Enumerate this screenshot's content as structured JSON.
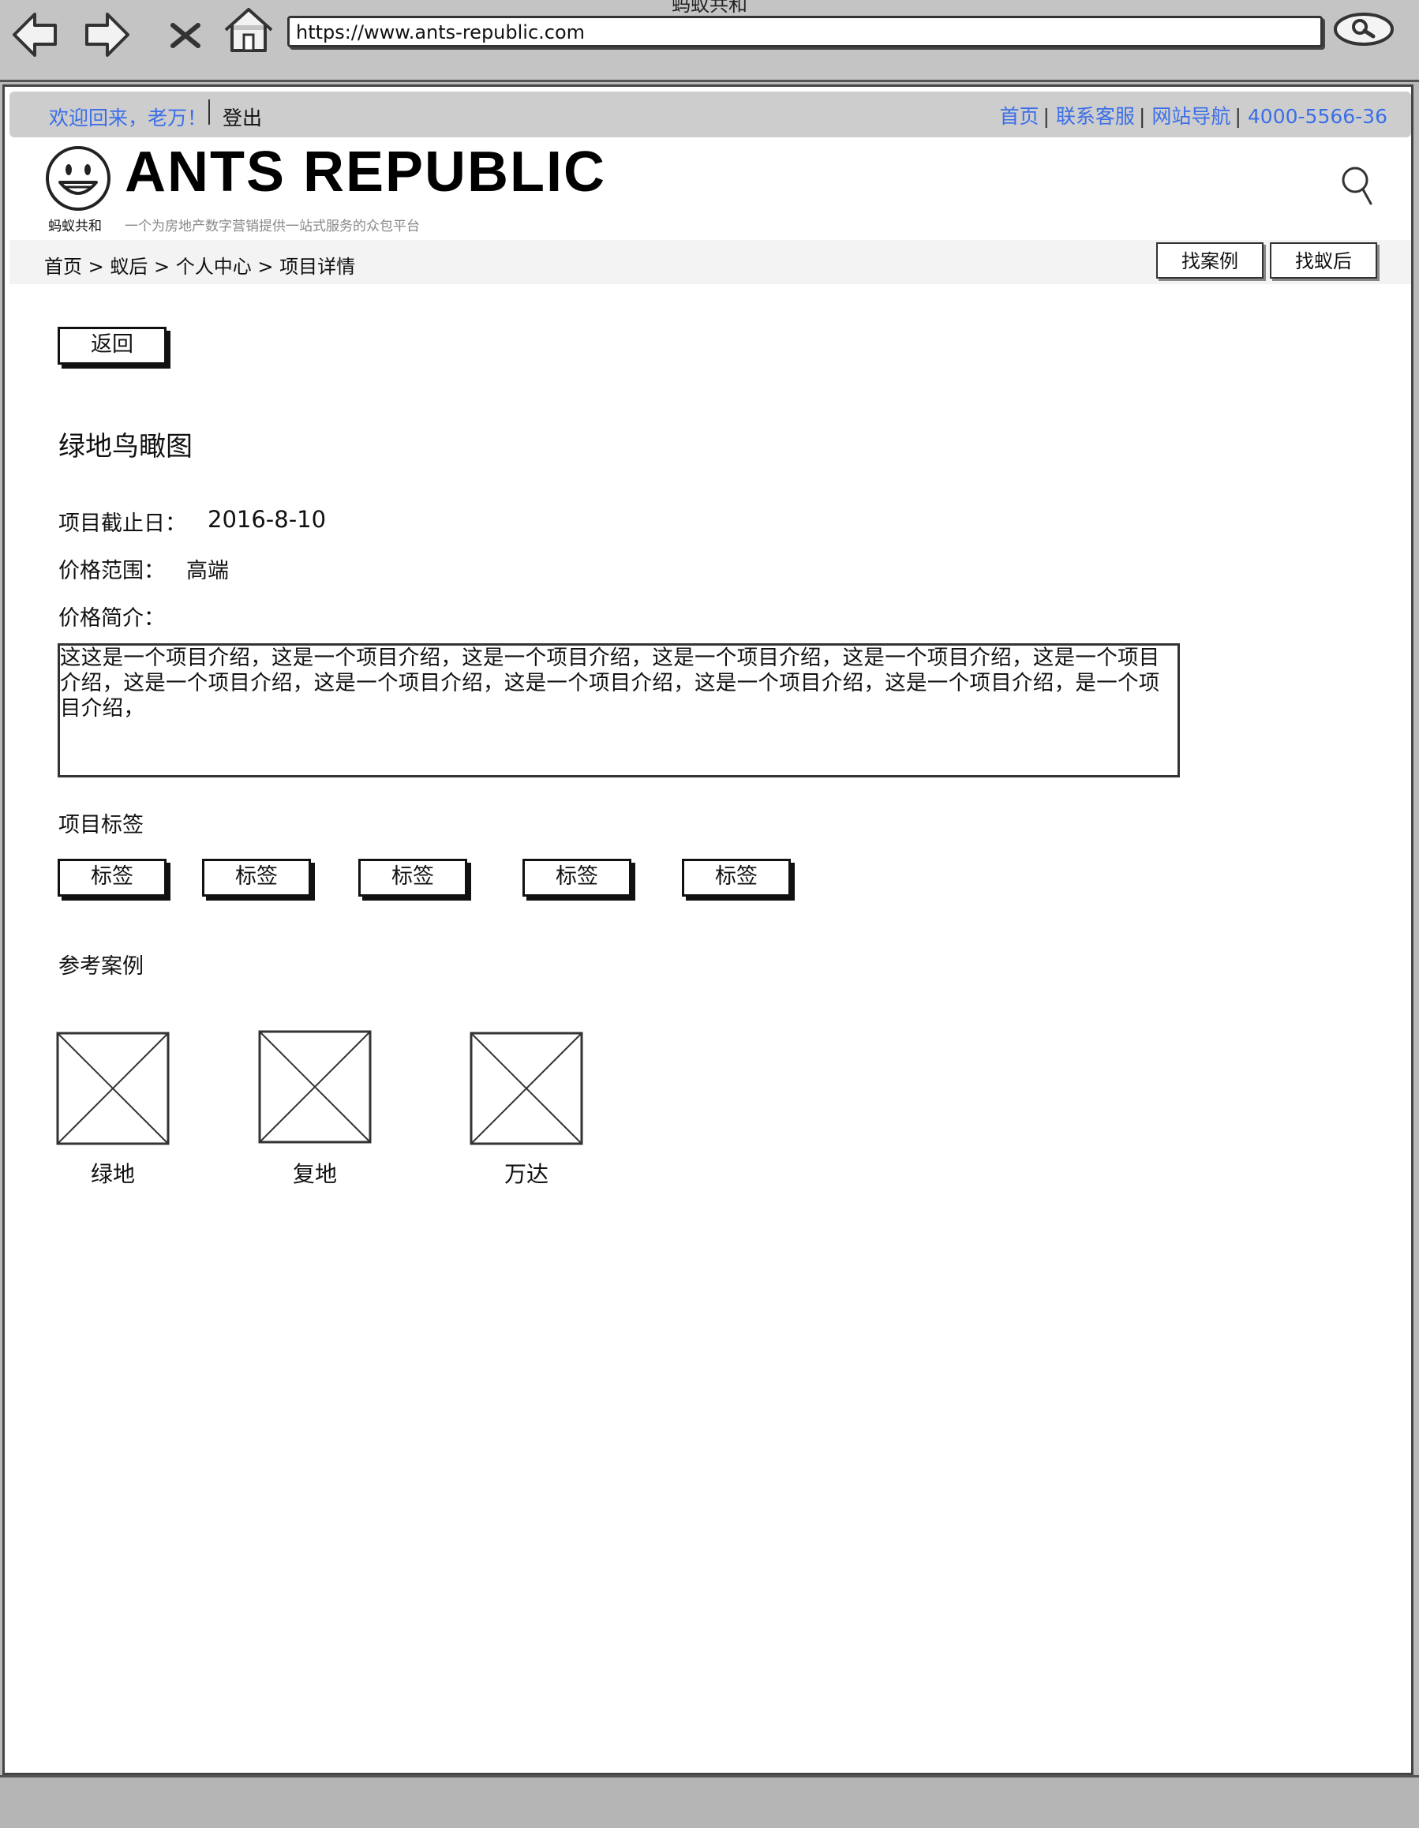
{
  "window": {
    "title": "蚂蚁共和",
    "url": "https://www.ants-republic.com"
  },
  "top_bar": {
    "greeting": "欢迎回来，老万！",
    "logout": "登出",
    "links": [
      "首页",
      "联系客服",
      "网站导航",
      "4000-5566-36"
    ]
  },
  "brand": {
    "name": "ANTS REPUBLIC",
    "cn_name": "蚂蚁共和",
    "slogan": "一个为房地产数字营销提供一站式服务的众包平台"
  },
  "breadcrumb": "首页 > 蚁后 > 个人中心 > 项目详情",
  "header_buttons": {
    "find_cases": "找案例",
    "find_ants": "找蚁后"
  },
  "main": {
    "back_button": "返回",
    "project_title": "绿地鸟瞰图",
    "deadline_label": "项目截止日：",
    "deadline_value": "2016-8-10",
    "price_range_label": "价格范围：",
    "price_range_value": "高端",
    "price_intro_label": "价格简介：",
    "price_intro_text": "这这是一个项目介绍，这是一个项目介绍，这是一个项目介绍，这是一个项目介绍，这是一个项目介绍，这是一个项目介绍，这是一个项目介绍，这是一个项目介绍，这是一个项目介绍，这是一个项目介绍，这是一个项目介绍，是一个项目介绍，",
    "tags_label": "项目标签",
    "tags": [
      "标签",
      "标签",
      "标签",
      "标签",
      "标签"
    ],
    "cases_label": "参考案例",
    "cases": [
      "绿地",
      "复地",
      "万达"
    ]
  },
  "colors": {
    "link": "#3b6ee8",
    "chrome": "#c4c4c4",
    "strip": "#cdcdcd"
  }
}
